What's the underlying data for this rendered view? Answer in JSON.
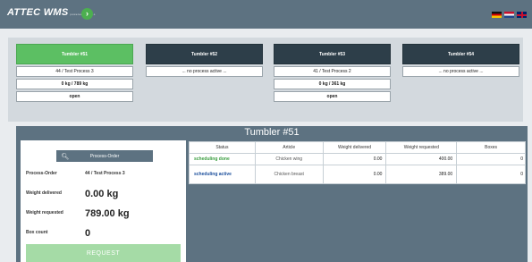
{
  "app": {
    "logo_text": "ATTEC WMS",
    "logo_sub": "powered by BULL",
    "nav_button_icon": "chevron-right-icon",
    "languages": [
      "de",
      "nl",
      "en"
    ]
  },
  "tumblers": [
    {
      "name": "Tumbler #51",
      "active": true,
      "order": "44 / Test Process 3",
      "weight": "0 kg / 789 kg",
      "state": "open"
    },
    {
      "name": "Tumbler #52",
      "active": false,
      "order": "... no process active ..."
    },
    {
      "name": "Tumbler #53",
      "active": false,
      "order": "41 / Test Process 2",
      "weight": "0 kg / 361 kg",
      "state": "open"
    },
    {
      "name": "Tumbler #54",
      "active": false,
      "order": "... no process active ..."
    }
  ],
  "detail": {
    "title": "Tumbler #51",
    "search_label": "Process-Order",
    "search_icon": "search-icon",
    "process_order_label": "Process-Order",
    "process_order_value": "44 / Test Process 3",
    "weight_delivered_label": "Weight delivered",
    "weight_delivered_value": "0.00 kg",
    "weight_requested_label": "Weight requested",
    "weight_requested_value": "789.00 kg",
    "box_count_label": "Box count",
    "box_count_value": "0",
    "request_label": "REQUEST"
  },
  "table": {
    "headers": [
      "Status",
      "Article",
      "Weight delivered",
      "Weight requested",
      "Boxes"
    ],
    "rows": [
      {
        "status": "scheduling done",
        "article": "Chicken wing",
        "weight_delivered": "0.00",
        "weight_requested": "400.00",
        "boxes": "0"
      },
      {
        "status": "scheduling active",
        "article": "Chicken breast",
        "weight_delivered": "0.00",
        "weight_requested": "389.00",
        "boxes": "0"
      }
    ]
  },
  "colors": {
    "header_bg": "#5d7281",
    "active_tumbler": "#5cbf63",
    "tumbler_header": "#2d3e49",
    "status_done": "#3a9d3f",
    "status_active": "#1c4f9c",
    "request_button": "#a5dba6"
  }
}
